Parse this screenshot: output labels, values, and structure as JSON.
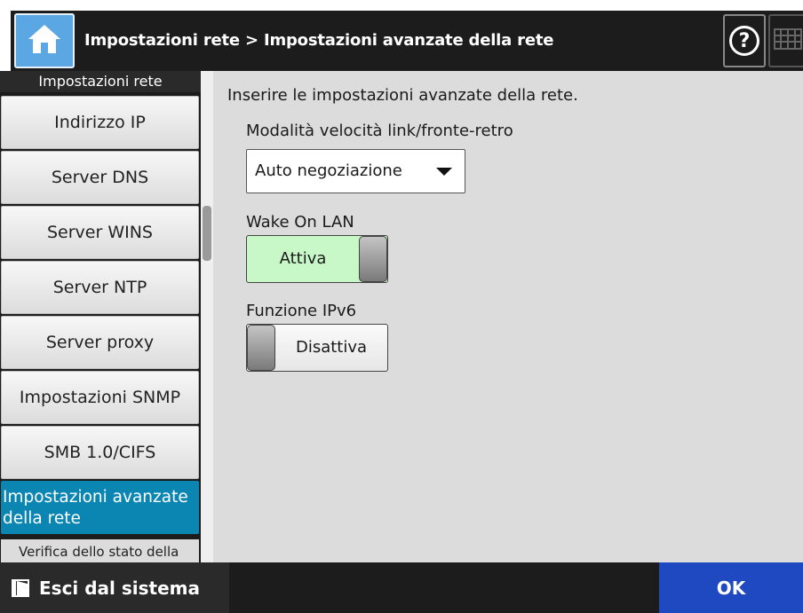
{
  "header": {
    "breadcrumb": "Impostazioni rete > Impostazioni avanzate della rete",
    "help_label": "?"
  },
  "sidebar": {
    "title": "Impostazioni rete",
    "items": [
      {
        "label": "Indirizzo IP"
      },
      {
        "label": "Server DNS"
      },
      {
        "label": "Server WINS"
      },
      {
        "label": "Server NTP"
      },
      {
        "label": "Server proxy"
      },
      {
        "label": "Impostazioni SNMP"
      },
      {
        "label": "SMB 1.0/CIFS"
      },
      {
        "label": "Impostazioni avanzate della rete"
      },
      {
        "label": "Verifica dello stato della"
      }
    ]
  },
  "main": {
    "instruction": "Inserire le impostazioni avanzate della rete.",
    "link_speed": {
      "label": "Modalità velocità link/fronte-retro",
      "value": "Auto negoziazione"
    },
    "wake_on_lan": {
      "label": "Wake On LAN",
      "state": "Attiva"
    },
    "ipv6": {
      "label": "Funzione IPv6",
      "state": "Disattiva"
    }
  },
  "footer": {
    "logout_label": "Esci dal sistema",
    "ok_label": "OK"
  },
  "colors": {
    "header_bg": "#1c1c1c",
    "active_nav": "#0b86b3",
    "toggle_on": "#c8f8c8",
    "ok_button": "#1e49c0"
  }
}
